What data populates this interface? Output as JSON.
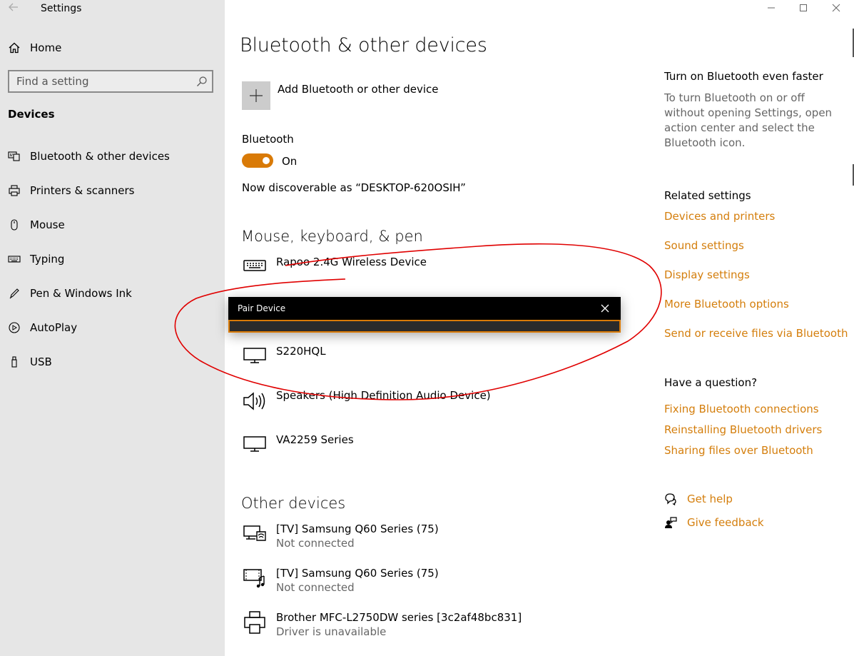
{
  "window": {
    "app_title": "Settings"
  },
  "sidebar": {
    "home_label": "Home",
    "search_placeholder": "Find a setting",
    "section": "Devices",
    "items": [
      {
        "label": "Bluetooth & other devices",
        "icon": "bluetooth-devices-icon"
      },
      {
        "label": "Printers & scanners",
        "icon": "printer-icon"
      },
      {
        "label": "Mouse",
        "icon": "mouse-icon"
      },
      {
        "label": "Typing",
        "icon": "keyboard-icon"
      },
      {
        "label": "Pen & Windows Ink",
        "icon": "pen-icon"
      },
      {
        "label": "AutoPlay",
        "icon": "autoplay-icon"
      },
      {
        "label": "USB",
        "icon": "usb-icon"
      }
    ]
  },
  "main": {
    "title": "Bluetooth & other devices",
    "add_device_label": "Add Bluetooth or other device",
    "bluetooth_label": "Bluetooth",
    "bluetooth_state": "On",
    "discoverable_text": "Now discoverable as “DESKTOP-620OSIH”",
    "mouse_section": "Mouse, keyboard, & pen",
    "mouse_devices": [
      {
        "name": "Rapoo 2.4G Wireless Device",
        "icon": "keyboard-icon"
      },
      {
        "name": "S220HQL",
        "icon": "monitor-icon"
      },
      {
        "name": "Speakers (High Definition Audio Device)",
        "icon": "speaker-icon"
      },
      {
        "name": "VA2259 Series",
        "icon": "monitor-icon"
      }
    ],
    "other_section": "Other devices",
    "other_devices": [
      {
        "name": "[TV] Samsung Q60 Series (75)",
        "status": "Not connected",
        "icon": "wireless-display-icon"
      },
      {
        "name": "[TV] Samsung Q60 Series (75)",
        "status": "Not connected",
        "icon": "media-device-icon"
      },
      {
        "name": "Brother MFC-L2750DW series [3c2af48bc831]",
        "status": "Driver is unavailable",
        "icon": "printer-icon"
      }
    ]
  },
  "right": {
    "faster_head": "Turn on Bluetooth even faster",
    "faster_desc": "To turn Bluetooth on or off without opening Settings, open action center and select the Bluetooth icon.",
    "related_head": "Related settings",
    "related_links": [
      "Devices and printers",
      "Sound settings",
      "Display settings",
      "More Bluetooth options",
      "Send or receive files via Bluetooth"
    ],
    "question_head": "Have a question?",
    "question_links": [
      "Fixing Bluetooth connections",
      "Reinstalling Bluetooth drivers",
      "Sharing files over Bluetooth"
    ],
    "get_help": "Get help",
    "give_feedback": "Give feedback"
  },
  "dialog": {
    "title": "Pair Device"
  },
  "colors": {
    "accent": "#d97a07",
    "link": "#d47e0c",
    "sidebar_bg": "#e6e6e6",
    "annotation": "#e00000"
  }
}
